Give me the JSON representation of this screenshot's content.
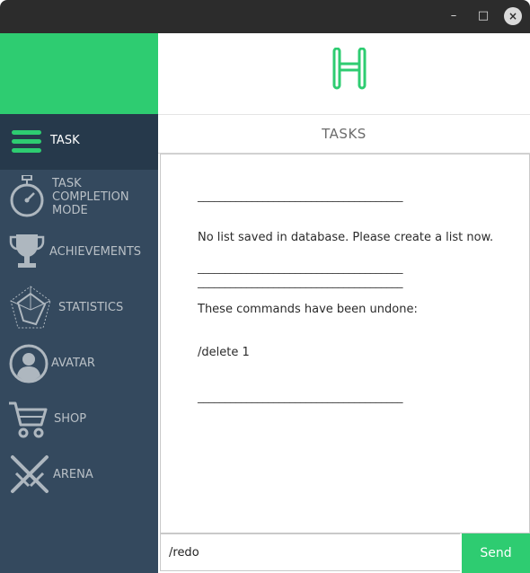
{
  "window": {
    "minimize_glyph": "–",
    "maximize_glyph": "□",
    "close_glyph": "×"
  },
  "brand": {
    "logo_letter": "H",
    "accent": "#2ecc71"
  },
  "sidebar": {
    "items": [
      {
        "label": "TASK",
        "icon": "menu-icon",
        "active": true
      },
      {
        "label": "TASK\nCOMPLETION\nMODE",
        "icon": "stopwatch-icon",
        "active": false
      },
      {
        "label": "ACHIEVEMENTS",
        "icon": "trophy-icon",
        "active": false
      },
      {
        "label": "STATISTICS",
        "icon": "radar-chart-icon",
        "active": false
      },
      {
        "label": "AVATAR",
        "icon": "user-avatar-icon",
        "active": false
      },
      {
        "label": "SHOP",
        "icon": "cart-icon",
        "active": false
      },
      {
        "label": "ARENA",
        "icon": "crossed-swords-icon",
        "active": false
      }
    ]
  },
  "main": {
    "header_title": "TASKS",
    "output": {
      "divider": "______________________________________",
      "message1": "No list saved in database. Please create a list now.",
      "message2_line1": "These commands have been undone:",
      "message2_line2": "/delete 1"
    },
    "command_input": {
      "value": "/redo"
    },
    "send_label": "Send"
  },
  "colors": {
    "sidebar_bg": "#34495e",
    "sidebar_active": "#26394b",
    "green": "#2ecc71"
  }
}
